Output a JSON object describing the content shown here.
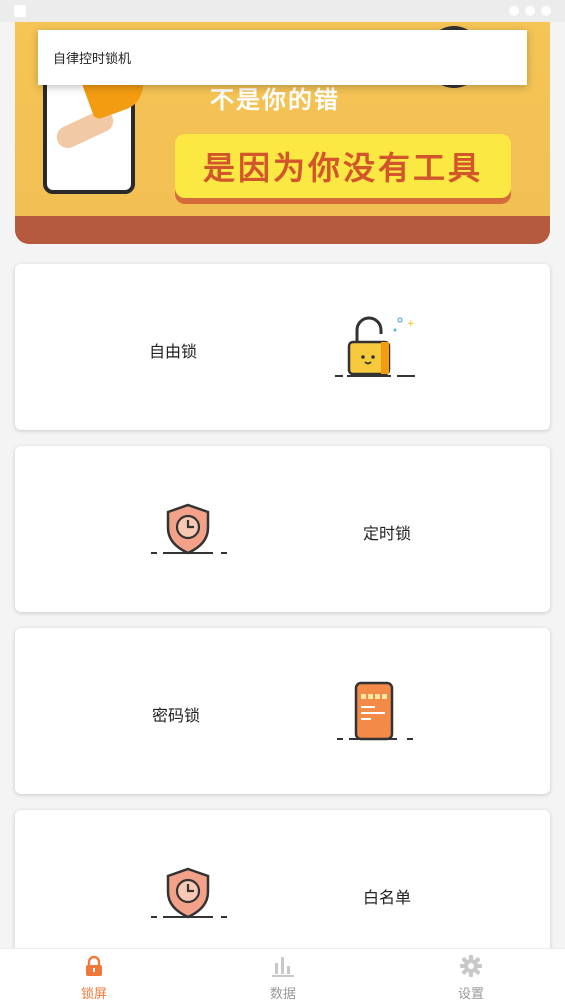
{
  "toast": {
    "text": "自律控时锁机"
  },
  "banner": {
    "line1": "不是你的错",
    "line2": "是因为你没有工具"
  },
  "cards": [
    {
      "label": "自由锁",
      "icon": "open-padlock-icon"
    },
    {
      "label": "定时锁",
      "icon": "shield-clock-icon"
    },
    {
      "label": "密码锁",
      "icon": "phone-keypad-icon"
    },
    {
      "label": "白名单",
      "icon": "shield-clock-icon"
    }
  ],
  "nav": {
    "items": [
      {
        "label": "锁屏",
        "icon": "lock-icon",
        "active": true
      },
      {
        "label": "数据",
        "icon": "bar-chart-icon",
        "active": false
      },
      {
        "label": "设置",
        "icon": "gear-icon",
        "active": false
      }
    ]
  },
  "colors": {
    "accent": "#f0793a",
    "inactive": "#c8c8c8",
    "banner_yellow": "#f5c555",
    "banner_brown": "#b55a3e"
  }
}
